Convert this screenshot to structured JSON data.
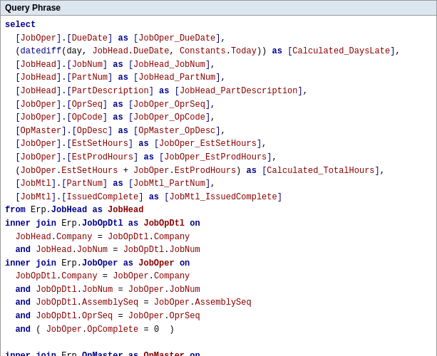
{
  "panel": {
    "title": "Query Phrase",
    "code_lines": []
  }
}
